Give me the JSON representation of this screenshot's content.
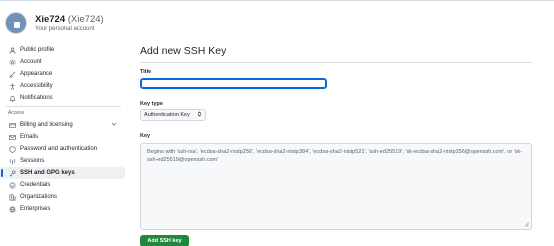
{
  "account": {
    "name": "Xie724",
    "handle": "(Xie724)",
    "subtitle": "Your personal account"
  },
  "sidebar": {
    "items_top": [
      {
        "label": "Public profile",
        "icon": "person-icon"
      },
      {
        "label": "Account",
        "icon": "gear-icon"
      },
      {
        "label": "Appearance",
        "icon": "paintbrush-icon"
      },
      {
        "label": "Accessibility",
        "icon": "accessibility-icon"
      },
      {
        "label": "Notifications",
        "icon": "bell-icon"
      }
    ],
    "access_label": "Access",
    "items_access": [
      {
        "label": "Billing and licensing",
        "icon": "credit-card-icon"
      },
      {
        "label": "Emails",
        "icon": "mail-icon"
      },
      {
        "label": "Password and authentication",
        "icon": "shield-lock-icon"
      },
      {
        "label": "Sessions",
        "icon": "broadcast-icon"
      },
      {
        "label": "SSH and GPG keys",
        "icon": "key-icon"
      },
      {
        "label": "Credentials",
        "icon": "passkey-icon"
      },
      {
        "label": "Organizations",
        "icon": "organization-icon"
      },
      {
        "label": "Enterprises",
        "icon": "globe-icon"
      }
    ],
    "active": "SSH and GPG keys"
  },
  "main": {
    "title": "Add new SSH Key",
    "title_label": "Title",
    "title_value": "",
    "key_type_label": "Key type",
    "key_type_value": "Authentication Key",
    "key_label": "Key",
    "key_placeholder": "Begins with 'ssh-rsa', 'ecdsa-sha2-nistp256', 'ecdsa-sha2-nistp384', 'ecdsa-sha2-nistp521', 'ssh-ed25519', 'sk-ecdsa-sha2-nistp256@openssh.com', or 'sk-ssh-ed25519@openssh.com'",
    "submit_label": "Add SSH key"
  },
  "colors": {
    "accent": "#0969da",
    "primary_button": "#1f883d",
    "text": "#1f2328",
    "muted": "#59636e",
    "border": "#d0d7de"
  }
}
